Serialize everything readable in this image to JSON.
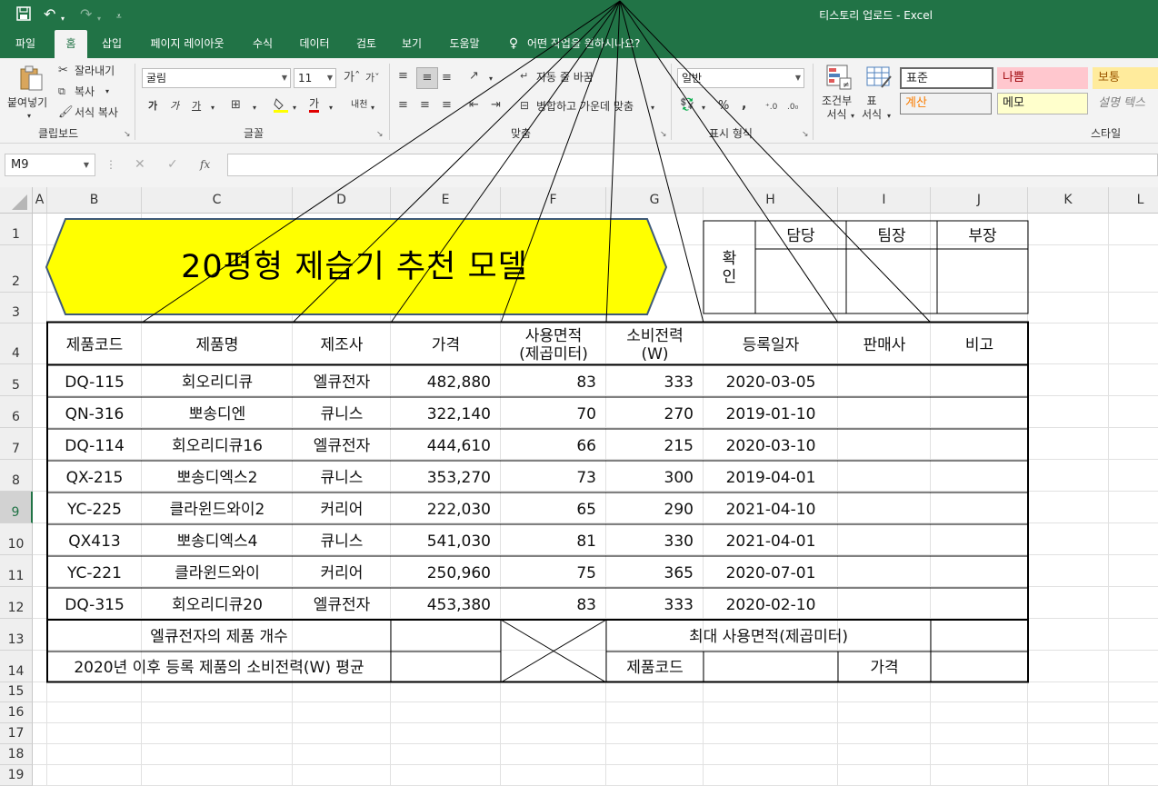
{
  "window": {
    "title": "티스토리 업로드  -  Excel",
    "quick_access": {
      "save_icon": "save-icon",
      "undo_icon": "undo-icon",
      "redo_icon": "redo-icon",
      "customize_icon": "customize-qat-icon"
    }
  },
  "ribbon_tabs": [
    "파일",
    "홈",
    "삽입",
    "페이지 레이아웃",
    "수식",
    "데이터",
    "검토",
    "보기",
    "도움말",
    "어떤 작업을 원하시나요?"
  ],
  "active_tab": "홈",
  "ribbon": {
    "clipboard": {
      "paste": "붙여넣기",
      "cut": "잘라내기",
      "copy": "복사",
      "format_painter": "서식 복사",
      "label": "클립보드"
    },
    "font": {
      "font_name": "굴림",
      "font_size": "11",
      "label": "글꼴",
      "bold": "가",
      "italic": "가",
      "underline": "가",
      "font_color_glyph": "가",
      "phonetic": "내천"
    },
    "alignment": {
      "wrap_text": "자동 줄 바꿈",
      "merge_center": "병합하고 가운데 맞춤",
      "label": "맞춤"
    },
    "number": {
      "format": "일반",
      "percent": "%",
      "comma": ",",
      "label": "표시 형식"
    },
    "styles": {
      "conditional": "조건부\n서식",
      "table": "표\n서식",
      "items": [
        "표준",
        "나쁨",
        "보통",
        "계산",
        "메모",
        "설명 텍스"
      ],
      "label": "스타일"
    }
  },
  "formula_bar": {
    "name_box": "M9",
    "fx": "fx",
    "formula": ""
  },
  "columns": [
    "A",
    "B",
    "C",
    "D",
    "E",
    "F",
    "G",
    "H",
    "I",
    "J",
    "K",
    "L"
  ],
  "rows": [
    "1",
    "2",
    "3",
    "4",
    "5",
    "6",
    "7",
    "8",
    "9",
    "10",
    "11",
    "12",
    "13",
    "14",
    "15",
    "16",
    "17",
    "18",
    "19"
  ],
  "selected_row": "9",
  "sheet": {
    "banner_title": "20평형 제습기 추천 모델",
    "approval": {
      "label": "확인",
      "roles": [
        "담당",
        "팀장",
        "부장"
      ]
    },
    "headers": [
      "제품코드",
      "제품명",
      "제조사",
      "가격",
      "사용면적\n(제곱미터)",
      "소비전력\n(W)",
      "등록일자",
      "판매사",
      "비고"
    ],
    "rows": [
      [
        "DQ-115",
        "회오리디큐",
        "엘큐전자",
        "482,880",
        "83",
        "333",
        "2020-03-05",
        "",
        ""
      ],
      [
        "QN-316",
        "뽀송디엔",
        "큐니스",
        "322,140",
        "70",
        "270",
        "2019-01-10",
        "",
        ""
      ],
      [
        "DQ-114",
        "회오리디큐16",
        "엘큐전자",
        "444,610",
        "66",
        "215",
        "2020-03-10",
        "",
        ""
      ],
      [
        "QX-215",
        "뽀송디엑스2",
        "큐니스",
        "353,270",
        "73",
        "300",
        "2019-04-01",
        "",
        ""
      ],
      [
        "YC-225",
        "클라윈드와이2",
        "커리어",
        "222,030",
        "65",
        "290",
        "2021-04-10",
        "",
        ""
      ],
      [
        "QX413",
        "뽀송디엑스4",
        "큐니스",
        "541,030",
        "81",
        "330",
        "2021-04-01",
        "",
        ""
      ],
      [
        "YC-221",
        "클라윈드와이",
        "커리어",
        "250,960",
        "75",
        "365",
        "2020-07-01",
        "",
        ""
      ],
      [
        "DQ-315",
        "회오리디큐20",
        "엘큐전자",
        "453,380",
        "83",
        "333",
        "2020-02-10",
        "",
        ""
      ]
    ],
    "summary": {
      "lq_count_label": "엘큐전자의 제품 개수",
      "avg_power_label": "2020년 이후 등록 제품의 소비전력(W) 평균",
      "max_area_label": "최대 사용면적(제곱미터)",
      "code_label": "제품코드",
      "price_label": "가격"
    }
  },
  "colors": {
    "excel_green": "#217346",
    "banner_fill": "#ffff00",
    "bad_bg": "#ffc7ce",
    "bad_fg": "#9c0006",
    "neutral_bg": "#ffeb9c",
    "neutral_fg": "#9c5700",
    "calc_fg": "#fa7d00",
    "note_bg": "#ffffcc"
  }
}
